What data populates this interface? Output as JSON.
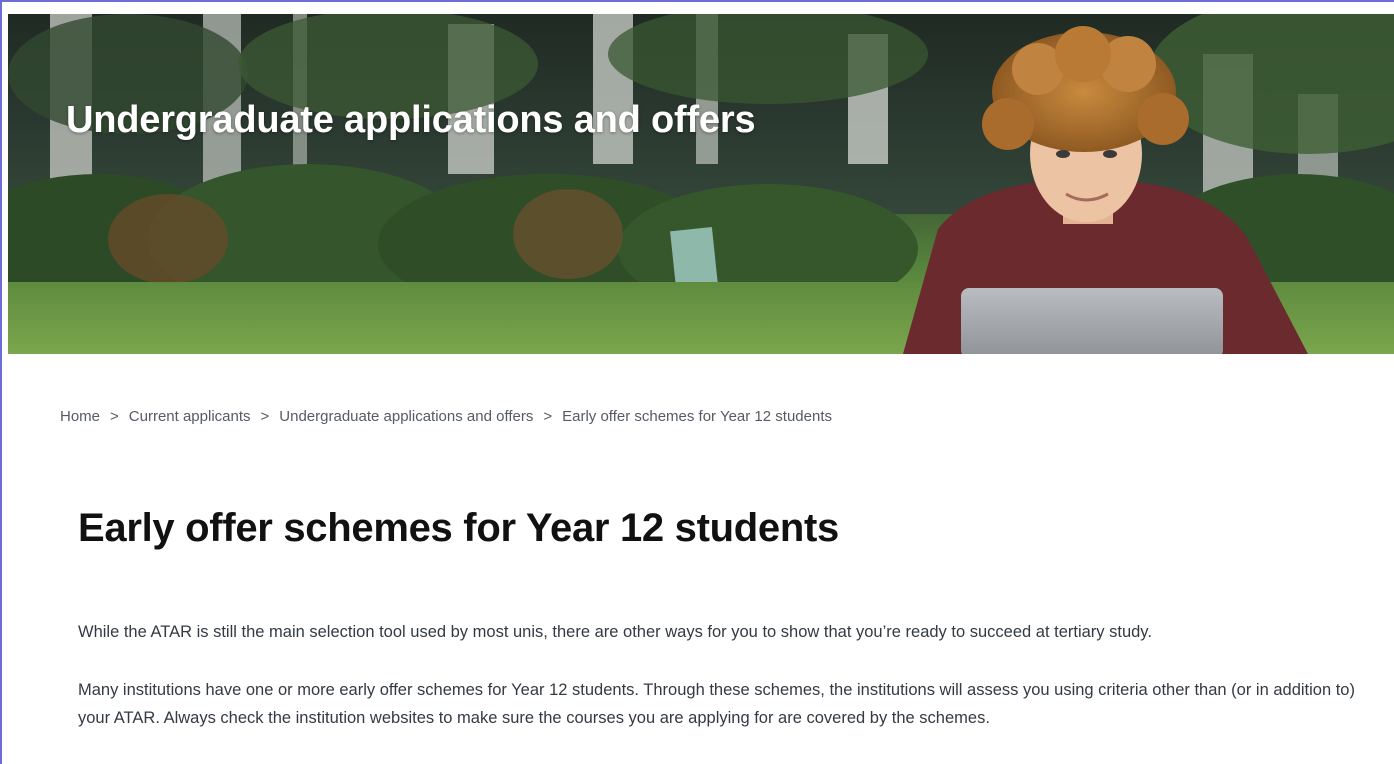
{
  "hero": {
    "title": "Undergraduate applications and offers",
    "image": "student-with-laptop-on-lawn"
  },
  "breadcrumb": {
    "items": [
      "Home",
      "Current applicants",
      "Undergraduate applications and offers",
      "Early offer schemes for Year 12 students"
    ],
    "separator": ">"
  },
  "page": {
    "title": "Early offer schemes for Year 12 students",
    "paragraphs": [
      "While the ATAR is still the main selection tool used by most unis, there are other ways for you to show that you’re ready to succeed at tertiary study.",
      "Many institutions have one or more early offer schemes for Year 12 students. Through these schemes, the institutions will assess you using criteria other than (or in addition to) your ATAR. Always check the institution websites to make sure the courses you are applying for are covered by the schemes."
    ]
  },
  "colors": {
    "frame": "#6d6cd9",
    "hero_text": "#ffffff",
    "body_text": "#333a42",
    "title_text": "#111111"
  }
}
